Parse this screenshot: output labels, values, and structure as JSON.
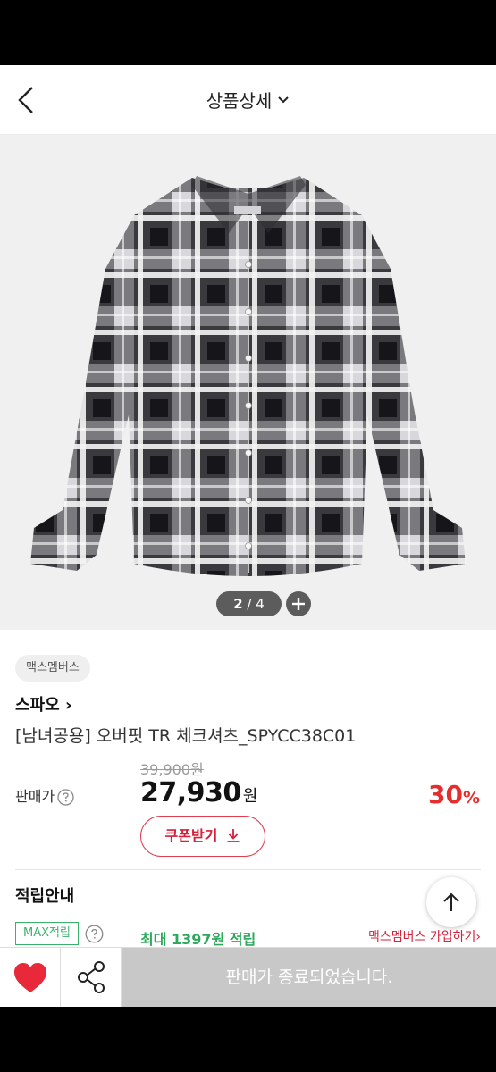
{
  "header": {
    "title": "상품상세"
  },
  "gallery": {
    "current": "2",
    "separator": " / ",
    "total": "4"
  },
  "product": {
    "badge": "맥스멤버스",
    "brand": "스파오 ›",
    "name": "[남녀공용] 오버핏 TR 체크셔츠_SPYCC38C01",
    "price_label": "판매가",
    "original_price": "39,900원",
    "sale_price": "27,930",
    "currency_unit": "원",
    "discount_value": "30",
    "discount_unit": "%",
    "coupon_label": "쿠폰받기"
  },
  "points": {
    "title": "적립안내",
    "max_tag": "MAX적립",
    "max_points_text": "최대 1397원 적립",
    "join_link": "맥스멤버스 가입하기›"
  },
  "bottom_bar": {
    "sold_out_text": "판매가 종료되었습니다."
  },
  "colors": {
    "accent_red": "#e62d2d",
    "coupon_red": "#d6203a",
    "point_green": "#2ea85c",
    "sold_out_gray": "#c8c8c8"
  },
  "icons": [
    "back-arrow-icon",
    "chevron-down-icon",
    "plus-icon",
    "question-circle-icon",
    "download-icon",
    "arrow-up-icon",
    "heart-icon",
    "share-icon"
  ]
}
